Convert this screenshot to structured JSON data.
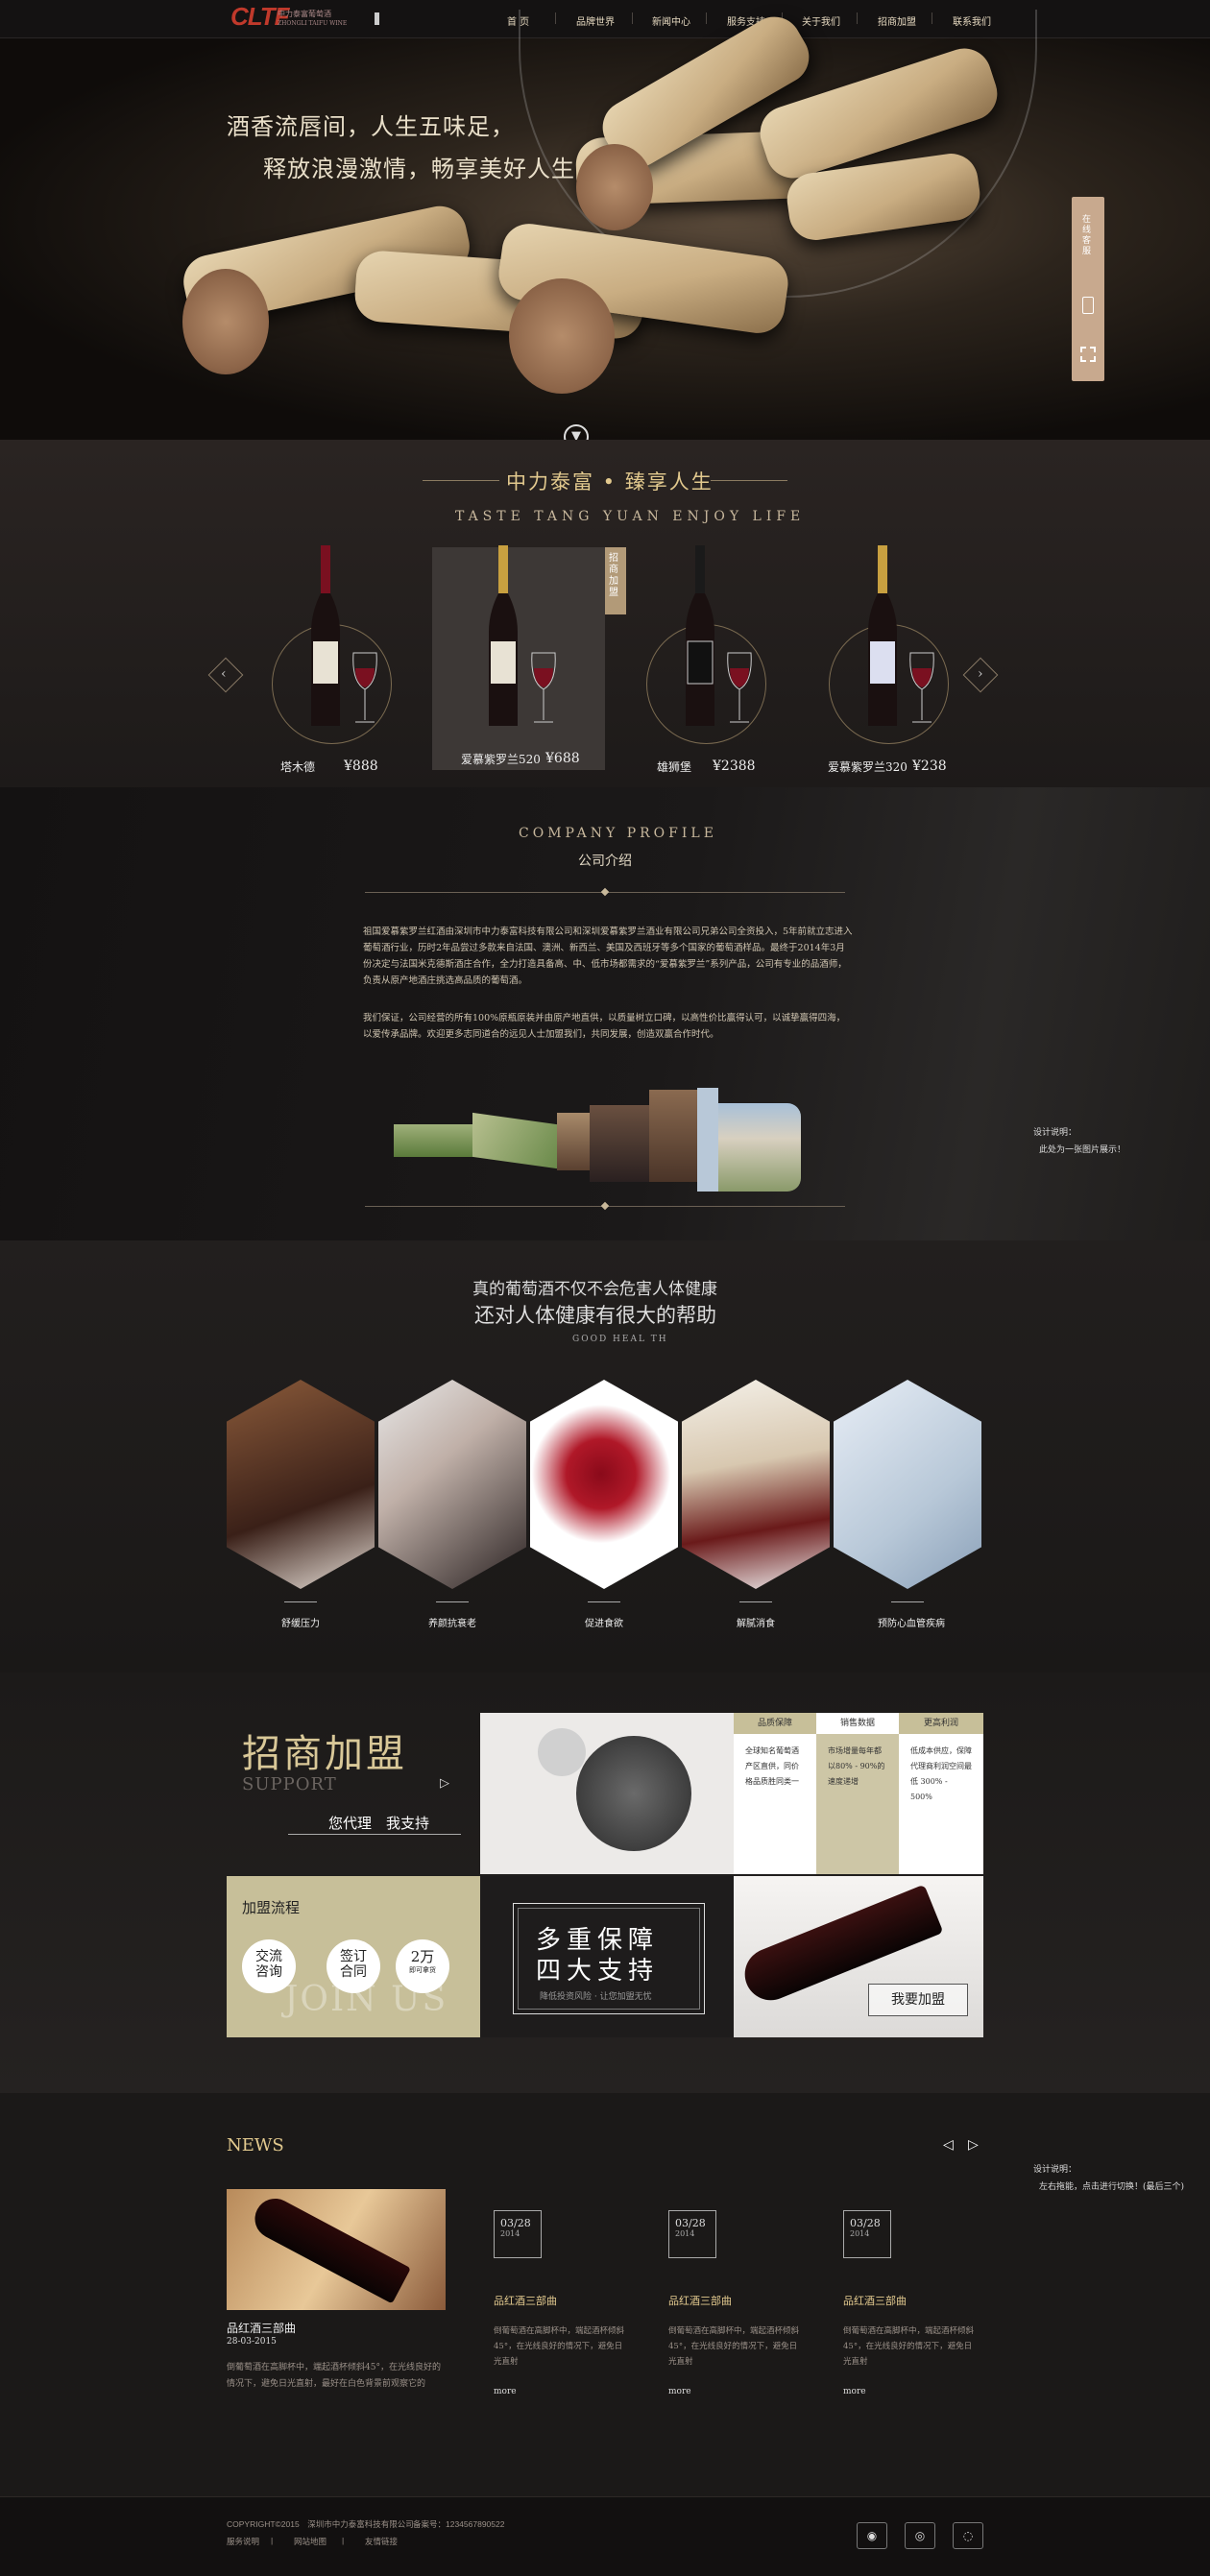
{
  "header": {
    "logo_mark": "CLTF",
    "logo_text_cn": "中力泰富葡萄酒",
    "logo_text_en": "ZHONGLI TAIFU WINE",
    "nav": [
      "首 页",
      "品牌世界",
      "新闻中心",
      "服务支持",
      "关于我们",
      "招商加盟",
      "联系我们"
    ]
  },
  "hero": {
    "line1": "酒香流唇间，人生五味足，",
    "line2": "释放浪漫激情，畅享美好人生",
    "side_tab_label": "在线客服",
    "down_icon": "chevron-down-icon"
  },
  "products": {
    "title": "中力泰富 • 臻享人生",
    "subtitle": "TASTE TANG YUAN ENJOY LIFE",
    "ribbon": "招商加盟",
    "items": [
      {
        "name": "塔木德",
        "price": "¥888"
      },
      {
        "name": "爱慕紫罗兰520",
        "price": "¥688"
      },
      {
        "name": "雄狮堡",
        "price": "¥2388"
      },
      {
        "name": "爱慕紫罗兰320",
        "price": "¥238"
      }
    ]
  },
  "company": {
    "title_en": "COMPANY PROFILE",
    "title_cn": "公司介绍",
    "para1": "祖国爱慕紫罗兰红酒由深圳市中力泰富科技有限公司和深圳爱慕紫罗兰酒业有限公司兄弟公司全资投入，5年前就立志进入葡萄酒行业，历时2年品尝过多款来自法国、澳洲、新西兰、美国及西班牙等多个国家的葡萄酒样品。最终于2014年3月份决定与法国米克德斯酒庄合作，全力打造具备高、中、低市场都需求的“爱慕紫罗兰”系列产品，公司有专业的品酒师，负责从原产地酒庄挑选高品质的葡萄酒。",
    "para2": "我们保证，公司经营的所有100%原瓶原装并由原产地直供，以质量树立口碑，以高性价比赢得认可，以诚挚赢得四海，以爱传承品牌。欢迎更多志同道合的远见人士加盟我们，共同发展，创造双赢合作时代。",
    "note_title": "设计说明：",
    "note_text": "此处为一张图片展示！"
  },
  "health": {
    "title1": "真的葡萄酒不仅不会危害人体健康",
    "title2": "还对人体健康有很大的帮助",
    "subtitle": "GOOD HEAL TH",
    "items": [
      "舒缓压力",
      "养颜抗衰老",
      "促进食欲",
      "解腻消食",
      "预防心血管疾病"
    ]
  },
  "support": {
    "title_cn": "招商加盟",
    "title_en": "SUPPORT",
    "slogan": "您代理　我支持",
    "tabs": [
      "品质保障",
      "销售数据",
      "更高利润"
    ],
    "col1": "全球知名葡萄酒产区直供，同价格品质胜同类一",
    "col2": "市场增量每年都以80% - 90%的速度递增",
    "col3": "低成本供应，保障代理商利润空间最低 300% - 500%",
    "process_title": "加盟流程",
    "steps": [
      {
        "a": "交流",
        "b": "咨询"
      },
      {
        "a": "签订",
        "b": "合同"
      },
      {
        "a": "2万",
        "b": "即可拿货"
      }
    ],
    "join_bg": "JOIN US",
    "guarantee1": "多重保障",
    "guarantee2": "四大支持",
    "guarantee_sub": "降低投资风险 · 让您加盟无忧",
    "join_button": "我要加盟"
  },
  "news": {
    "title": "NEWS",
    "feature": {
      "title": "品红酒三部曲",
      "date": "28-03-2015",
      "text": "倒葡萄酒在高脚杯中，端起酒杯倾斜45°，在光线良好的情况下，避免日光直射，最好在白色背景前观察它的"
    },
    "items": [
      {
        "day": "03/28",
        "year": "2014",
        "title": "品红酒三部曲",
        "text": "倒葡萄酒在高脚杯中，端起酒杯倾斜45°，在光线良好的情况下，避免日光直射",
        "more": "more"
      },
      {
        "day": "03/28",
        "year": "2014",
        "title": "品红酒三部曲",
        "text": "倒葡萄酒在高脚杯中，端起酒杯倾斜45°，在光线良好的情况下，避免日光直射",
        "more": "more"
      },
      {
        "day": "03/28",
        "year": "2014",
        "title": "品红酒三部曲",
        "text": "倒葡萄酒在高脚杯中，端起酒杯倾斜45°，在光线良好的情况下，避免日光直射",
        "more": "more"
      }
    ],
    "note_title": "设计说明：",
    "note_text": "左右拖能，点击进行切换！(最后三个)"
  },
  "footer": {
    "copyright": "COPYRIGHT©2015　深圳市中力泰富科技有限公司",
    "icp": "备案号：1234567890522",
    "links": [
      "服务说明",
      "网站地图",
      "友情链接"
    ],
    "icons": [
      "qq-icon",
      "wechat-icon",
      "weibo-icon"
    ]
  }
}
